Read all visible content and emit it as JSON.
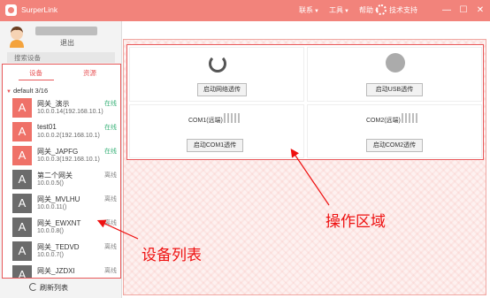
{
  "window": {
    "title": "SurperLink",
    "menus": [
      "联系",
      "工具",
      "帮助"
    ],
    "support": "技术支持",
    "controls": [
      "—",
      "☐",
      "✕"
    ]
  },
  "user": {
    "logout": "退出"
  },
  "search": {
    "placeholder": "搜索设备"
  },
  "tabs": {
    "devices": "设备",
    "resources": "资源"
  },
  "group": "default 3/16",
  "devices": [
    {
      "avatar": "A",
      "name": "网关_演示",
      "ip": "10.0.0.14(192.168.10.1)",
      "status": "在线",
      "online": true
    },
    {
      "avatar": "A",
      "name": "test01",
      "ip": "10.0.0.2(192.168.10.1)",
      "status": "在线",
      "online": true
    },
    {
      "avatar": "A",
      "name": "网关_JAPFG",
      "ip": "10.0.0.3(192.168.10.1)",
      "status": "在线",
      "online": true
    },
    {
      "avatar": "A",
      "name": "第二个网关",
      "ip": "10.0.0.5()",
      "status": "离线",
      "online": false
    },
    {
      "avatar": "A",
      "name": "网关_MVLHU",
      "ip": "10.0.0.11()",
      "status": "离线",
      "online": false
    },
    {
      "avatar": "A",
      "name": "网关_EWXNT",
      "ip": "10.0.0.8()",
      "status": "离线",
      "online": false
    },
    {
      "avatar": "A",
      "name": "网关_TEDVD",
      "ip": "10.0.0.7()",
      "status": "离线",
      "online": false
    },
    {
      "avatar": "A",
      "name": "网关_JZDXI",
      "ip": "",
      "status": "离线",
      "online": false
    }
  ],
  "refresh": "刷新列表",
  "operations": {
    "net_button": "启动网络透传",
    "usb_button": "启动USB透传",
    "com1_label": "COM1(远端)",
    "com1_button": "启动COM1透传",
    "com2_label": "COM2(远端)",
    "com2_button": "启动COM2透传"
  },
  "annotations": {
    "device_list": "设备列表",
    "operation_area": "操作区域"
  },
  "colors": {
    "accent": "#f2837b",
    "annotation_red": "#e11111",
    "online_green": "#3bb27a",
    "offline_avatar": "#6b6b6b"
  }
}
